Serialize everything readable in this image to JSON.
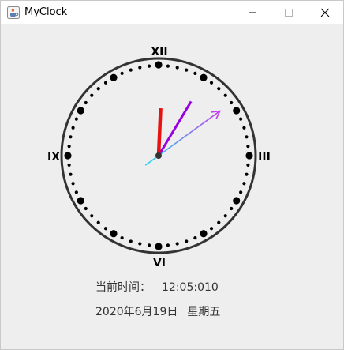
{
  "window": {
    "title": "MyClock",
    "icons": {
      "app": "java-coffee-cup-icon",
      "minimize": "minimize-icon",
      "maximize": "maximize-icon",
      "close": "close-icon"
    }
  },
  "clock": {
    "numerals": {
      "twelve": "XII",
      "three": "III",
      "six": "VI",
      "nine": "IX"
    },
    "time": {
      "hours": 12,
      "minutes": 5,
      "seconds": 10
    },
    "colors": {
      "face_ring": "#333333",
      "dots": "#000000",
      "hour_hand": "#e81212",
      "minute_hand": "#9a00e0",
      "second_hand_start": "#22d6f0",
      "second_hand_end": "#c23ef0"
    }
  },
  "info": {
    "time_label": "当前时间：",
    "time_value": "12:05:010",
    "date_text": "2020年6月19日",
    "weekday_text": "星期五"
  }
}
